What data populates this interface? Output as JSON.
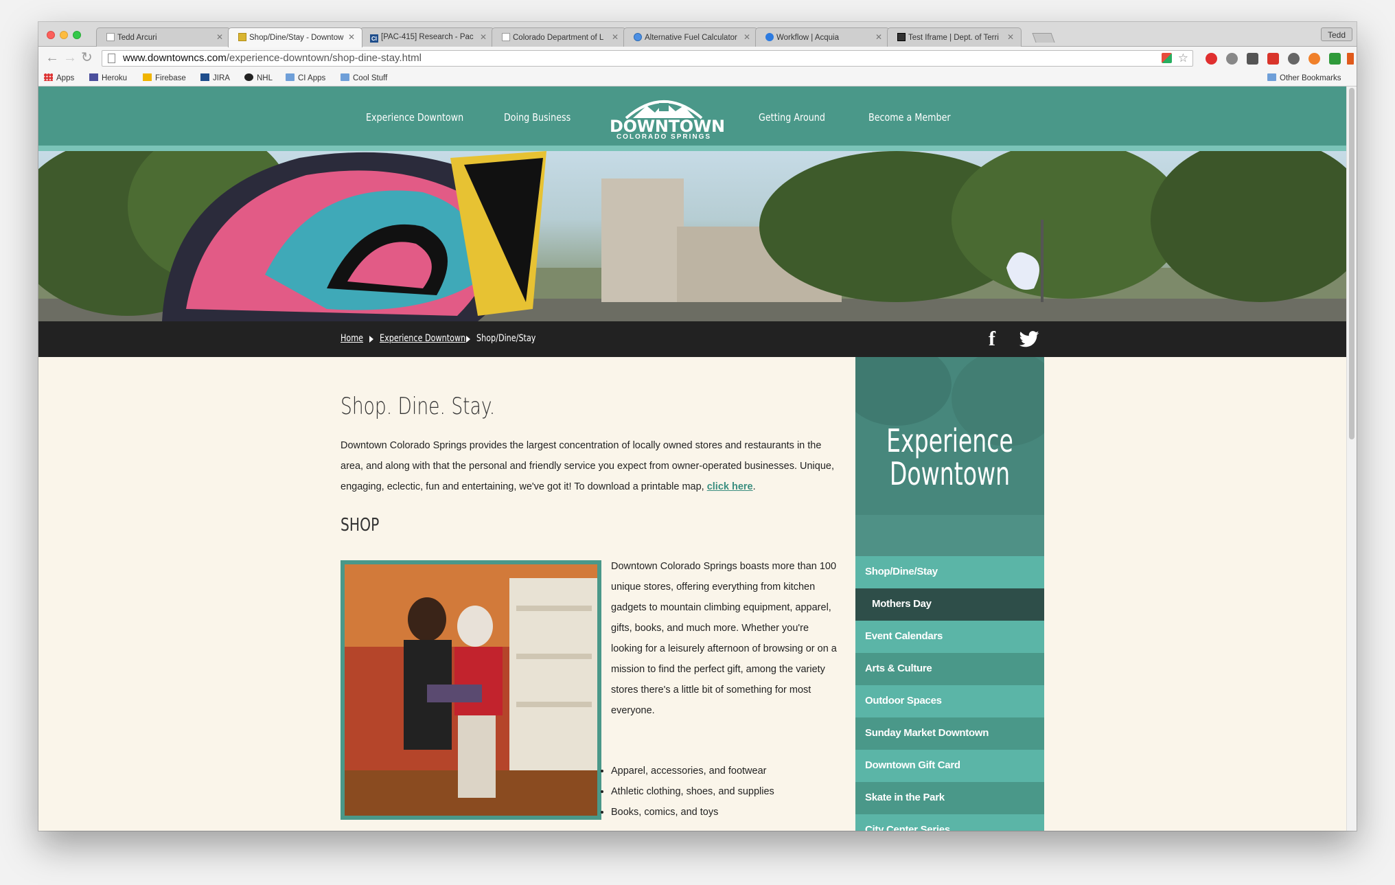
{
  "browser": {
    "profile": "Tedd",
    "tabs": [
      {
        "title": "Tedd Arcuri",
        "icon": "page-icon"
      },
      {
        "title": "Shop/Dine/Stay - Downtow",
        "icon": "downtown-icon",
        "active": true
      },
      {
        "title": "[PAC-415] Research - Pac",
        "icon": "ci-icon"
      },
      {
        "title": "Colorado Department of L",
        "icon": "page-icon"
      },
      {
        "title": "Alternative Fuel Calculator",
        "icon": "user-icon"
      },
      {
        "title": "Workflow | Acquia",
        "icon": "globe-icon"
      },
      {
        "title": "Test Iframe | Dept. of Terri",
        "icon": "bookmark-icon"
      }
    ],
    "address": {
      "host": "www.downtowncs.com",
      "path": "/experience-downtown/shop-dine-stay.html"
    },
    "bookmarks": [
      {
        "label": "Apps",
        "icon": "apps-icon"
      },
      {
        "label": "Heroku",
        "icon": "heroku-icon"
      },
      {
        "label": "Firebase",
        "icon": "firebase-icon"
      },
      {
        "label": "JIRA",
        "icon": "ci-icon"
      },
      {
        "label": "NHL",
        "icon": "nhl-icon"
      },
      {
        "label": "CI Apps",
        "icon": "folder-icon"
      },
      {
        "label": "Cool Stuff",
        "icon": "folder-icon"
      }
    ],
    "other_bookmarks": "Other Bookmarks"
  },
  "site": {
    "nav": [
      "Experience Downtown",
      "Doing Business",
      "Getting Around",
      "Become a Member"
    ],
    "logo": {
      "line1": "DOWNTOWN",
      "line2": "COLORADO SPRINGS"
    },
    "breadcrumb": [
      "Home",
      "Experience Downtown",
      "Shop/Dine/Stay"
    ],
    "page_title": "Shop. Dine. Stay.",
    "intro": "Downtown Colorado Springs provides the largest concentration of locally owned stores and restaurants in the area, and along with that the personal and friendly service you expect from owner-operated businesses. Unique, engaging, eclectic, fun and entertaining, we've got it! To download a printable map,",
    "intro_link": "click here",
    "intro_end": ".",
    "shop_heading": "SHOP",
    "shop_text": "Downtown Colorado Springs boasts more than 100 unique stores, offering everything from kitchen gadgets to mountain climbing equipment, apparel, gifts, books, and much more. Whether you're looking for a leisurely afternoon of browsing or on a mission to find the perfect gift, among the variety stores there's a little bit of something for most everyone.",
    "shop_bullets": [
      "Apparel, accessories, and footwear",
      "Athletic clothing, shoes, and supplies",
      "Books, comics, and toys"
    ],
    "sidebar_title": [
      "Experience",
      "Downtown"
    ],
    "sidebar_items": [
      "Shop/Dine/Stay",
      "Mothers Day",
      "Event Calendars",
      "Arts & Culture",
      "Outdoor Spaces",
      "Sunday Market Downtown",
      "Downtown Gift Card",
      "Skate in the Park",
      "City Center Series"
    ]
  },
  "colors": {
    "header": "#4a9889",
    "sidebar_light": "#5bb5a7",
    "sidebar_dark": "#2e4e49",
    "breadcrumb_bar": "#222222"
  }
}
